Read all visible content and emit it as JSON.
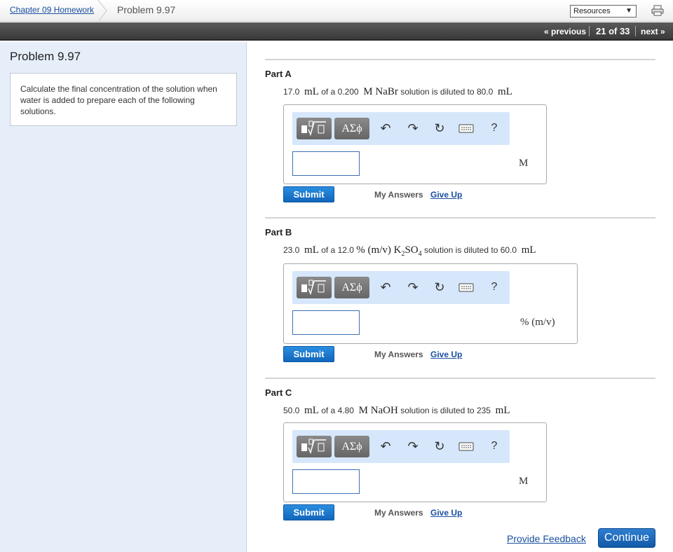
{
  "breadcrumb": {
    "parent": "Chapter 09 Homework",
    "current": "Problem 9.97"
  },
  "resources": {
    "label": "Resources",
    "arrow": "▼"
  },
  "nav": {
    "previous": "« previous",
    "count": "21 of 33",
    "next": "next »"
  },
  "problem": {
    "title": "Problem 9.97",
    "intro": "Calculate the final concentration of the solution when water is added to prepare each of the following solutions."
  },
  "toolbar": {
    "greek": "ΑΣϕ",
    "help": "?"
  },
  "parts": [
    {
      "label": "Part A",
      "q_vol": "17.0",
      "q_vol_unit": "mL",
      "q_of_a": "of a",
      "q_conc": "0.200",
      "q_solute": "M NaBr",
      "q_mid": "solution is diluted to",
      "q_final": "80.0",
      "q_final_unit": "mL",
      "unit": "M",
      "input_value": ""
    },
    {
      "label": "Part B",
      "q_vol": "23.0",
      "q_vol_unit": "mL",
      "q_of_a": "of a",
      "q_conc": "12.0",
      "q_solute": "% (m/v) K",
      "q_sub1": "2",
      "q_solute2": "SO",
      "q_sub2": "4",
      "q_mid": "solution is diluted to",
      "q_final": "60.0",
      "q_final_unit": "mL",
      "unit": "% (m/v)",
      "input_value": ""
    },
    {
      "label": "Part C",
      "q_vol": "50.0",
      "q_vol_unit": "mL",
      "q_of_a": "of a",
      "q_conc": "4.80",
      "q_solute": "M NaOH",
      "q_mid": "solution is diluted to",
      "q_final": "235",
      "q_final_unit": "mL",
      "unit": "M",
      "input_value": ""
    }
  ],
  "actions": {
    "submit": "Submit",
    "my_answers": "My Answers",
    "give_up": "Give Up"
  },
  "footer": {
    "feedback": "Provide Feedback",
    "continue": "Continue"
  },
  "colors": {
    "accent": "#1166bb",
    "left_panel": "#e6eff9",
    "toolbar_bg": "#d6e7fb"
  }
}
